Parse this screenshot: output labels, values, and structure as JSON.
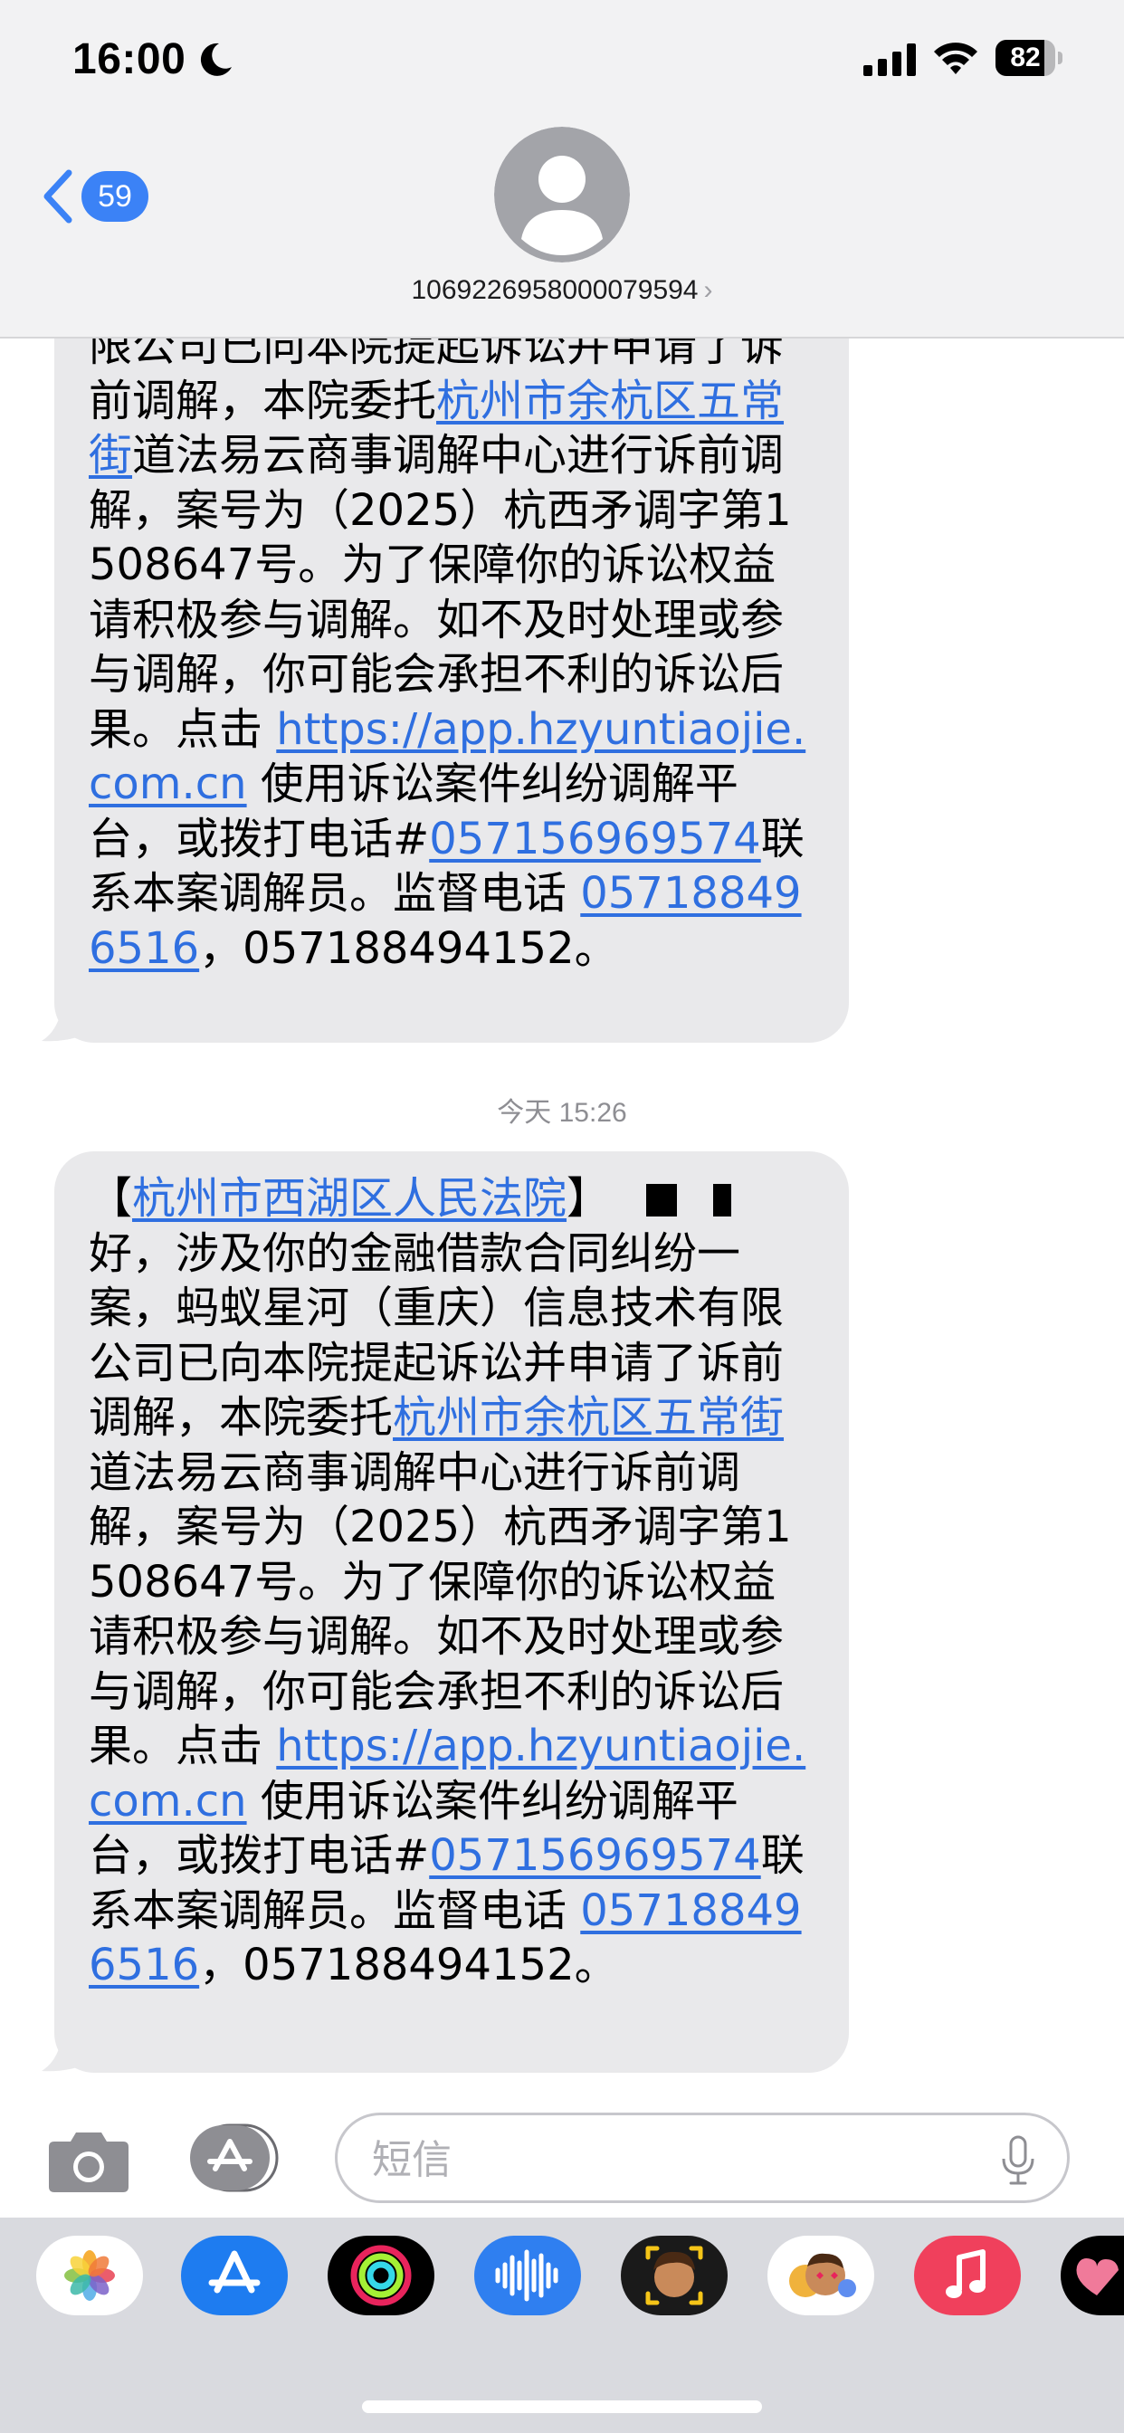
{
  "status_bar": {
    "time": "16:00",
    "battery_level": 82,
    "battery_text": "82"
  },
  "nav": {
    "back_badge": "59",
    "contact_name": "1069226958000079594",
    "contact_chevron": "›"
  },
  "messages": {
    "first": {
      "top_partial": "限公司已向本院提起诉讼并申请了",
      "p1": "诉前调解，本院委托",
      "link_place": "杭州市余杭区五常街",
      "p2": "道法易云商事调解中心进行诉前调解，案号为（2025）杭西矛调字第1508647号。为了保障你的诉讼权益请积极参与调解。如不及时处理或参与调解，你可能会承担不利的诉讼后果。点击 ",
      "link_url": "https://app.hzyuntiaojie.com.cn",
      "p3": " 使用诉讼案件纠纷调解平台，或拨打电话#",
      "link_phone": "057156969574",
      "p4": "联系本案调解员。监督电话 ",
      "link_supervise": "057188496516",
      "p5": "，057188494152。"
    },
    "timestamp": "今天 15:26",
    "second": {
      "bracket_open": "【",
      "link_court": "杭州市西湖区人民法院",
      "bracket_close": "】",
      "p0": "好，涉及你的金融借款合同纠纷一案，蚂蚁星河（重庆）信息技术有限公司已向本院提起诉讼并申请了",
      "p1": "诉前调解，本院委托",
      "link_place": "杭州市余杭区五常街",
      "p2": "道法易云商事调解中心进行诉前调解，案号为（2025）杭西矛调字第1508647号。为了保障你的诉讼权益请积极参与调解。如不及时处理或参与调解，你可能会承担不利的诉讼后果。点击 ",
      "link_url": "https://app.hzyuntiaojie.com.cn",
      "p3": " 使用诉讼案件纠纷调解平台，或拨打电话#",
      "link_phone": "057156969574",
      "p4": "联系本案调解员。监督电话 ",
      "link_supervise": "057188496516",
      "p5": "，057188494152。"
    }
  },
  "compose": {
    "placeholder": "短信"
  },
  "colors": {
    "link": "#2f6fe0",
    "badge": "#3b82f6",
    "bubble": "#e9e9eb",
    "header": "#f2f2f3",
    "drawer": "#d9dadf"
  },
  "drawer_apps": [
    "photos-icon",
    "app-store-icon",
    "fitness-icon",
    "audio-message-icon",
    "memoji-icon",
    "memoji-stickers-icon",
    "music-icon",
    "digital-touch-icon"
  ]
}
